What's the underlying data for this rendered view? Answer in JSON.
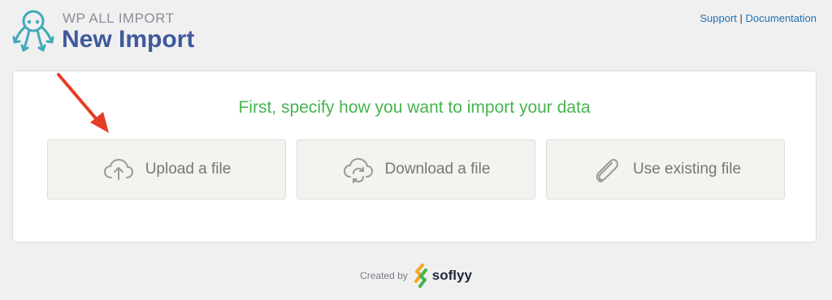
{
  "header": {
    "brand_small": "WP ALL IMPORT",
    "title": "New Import",
    "links": {
      "support": "Support",
      "separator": "|",
      "documentation": "Documentation"
    }
  },
  "panel": {
    "heading": "First, specify how you want to import your data",
    "options": [
      {
        "label": "Upload a file",
        "icon": "cloud-upload-icon"
      },
      {
        "label": "Download a file",
        "icon": "cloud-sync-icon"
      },
      {
        "label": "Use existing file",
        "icon": "paperclip-icon"
      }
    ]
  },
  "footer": {
    "created_by": "Created by",
    "brand": "soflyy"
  },
  "colors": {
    "brand_blue": "#40599c",
    "logo_teal": "#41aab9",
    "heading_green": "#46b450",
    "link_blue": "#2271b1",
    "annotation_red": "#e53e26"
  }
}
